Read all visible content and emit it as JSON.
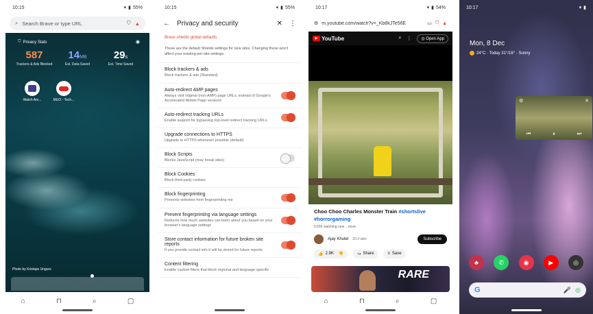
{
  "phone1": {
    "status_time": "10:15",
    "status_battery": "55%",
    "search_placeholder": "Search Brave or type URL",
    "stats_title": "Privacy Stats",
    "stats": [
      {
        "num": "587",
        "unit": "",
        "label": "Trackers & Ads Blocked",
        "color": "#fb8c50"
      },
      {
        "num": "14",
        "unit": "MB",
        "label": "Est. Data Saved",
        "color": "#8ba7ff"
      },
      {
        "num": "29",
        "unit": "s",
        "label": "Est. Time Saved",
        "color": "#ffffff"
      }
    ],
    "tiles": [
      {
        "label": "Watch Am...",
        "icon": "tv-icon"
      },
      {
        "label": "MUO - Tech...",
        "icon": "muo-icon"
      }
    ],
    "photo_credit": "Photo by Kristaps Ungurs"
  },
  "phone2": {
    "status_time": "10:15",
    "status_battery": "55%",
    "title": "Privacy and security",
    "section_title": "Brave shields global defaults",
    "intro": "These are the default Shields settings for new sites. Changing these won't affect your existing per-site settings.",
    "settings": [
      {
        "title": "Block trackers & ads",
        "desc": "Block trackers & ads (Standard)",
        "toggle": "none"
      },
      {
        "title": "Auto-redirect AMP pages",
        "desc": "Always visit original (non-AMP) page URLs, instead of Google's Accelerated Mobile Page versions",
        "toggle": "on"
      },
      {
        "title": "Auto-redirect tracking URLs",
        "desc": "Enable support for bypassing top-level redirect tracking URLs.",
        "toggle": "on"
      },
      {
        "title": "Upgrade connections to HTTPS",
        "desc": "Upgrade to HTTPS whenever possible (default)",
        "toggle": "none"
      },
      {
        "title": "Block Scripts",
        "desc": "Blocks JavaScript (may break sites)",
        "toggle": "off"
      },
      {
        "title": "Block Cookies",
        "desc": "Block third-party cookies",
        "toggle": "none"
      },
      {
        "title": "Block fingerprinting",
        "desc": "Prevents websites from fingerprinting me",
        "toggle": "on"
      },
      {
        "title": "Prevent fingerprinting via language settings",
        "desc": "Reduces how much websites can learn about you based on your browser's language settings",
        "toggle": "on"
      },
      {
        "title": "Store contact information for future broken site reports",
        "desc": "If you provide contact info it will be stored for future reports",
        "toggle": "on"
      },
      {
        "title": "Content filtering",
        "desc": "Enable custom filters that block regional and language-specific",
        "toggle": "none"
      }
    ]
  },
  "phone3": {
    "status_time": "10:17",
    "status_battery": "54%",
    "url": "m.youtube.com/watch?v=_Kb8kJTe56E",
    "yt_logo": "YouTube",
    "open_app": "Open App",
    "video_title": "Choo Choo Charles Monster Train",
    "tag1": "#shortslive",
    "tag2": "#horrorgaming",
    "meta": "5,655 watching now",
    "meta_more": "...more",
    "channel": "Ajay Khutel",
    "subs": "20.4 lakh",
    "subscribe": "Subscribe",
    "likes": "2.9K",
    "share": "Share",
    "save": "Save",
    "thumb_text": "RARE"
  },
  "phone4": {
    "status_time": "10:17",
    "date": "Mon, 8 Dec",
    "weather": "24°C · Today 31°/16° · Sunny"
  }
}
